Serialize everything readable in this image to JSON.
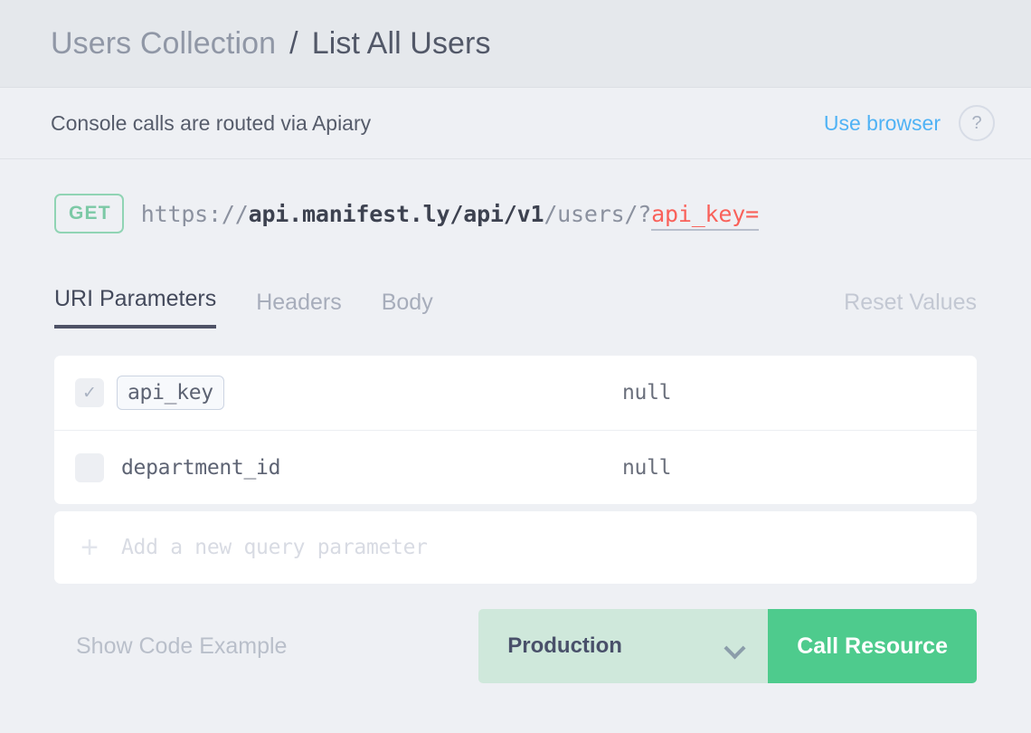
{
  "breadcrumb": {
    "parent": "Users Collection",
    "separator": "/",
    "current": "List All Users"
  },
  "console_notice": {
    "message": "Console calls are routed via Apiary",
    "use_browser_label": "Use browser",
    "help_icon": "?"
  },
  "request": {
    "method": "GET",
    "url_scheme": "https://",
    "url_host": "api.manifest.ly/api/v1",
    "url_path": "/users/?",
    "url_query": "api_key="
  },
  "tabs": [
    {
      "label": "URI Parameters",
      "active": true
    },
    {
      "label": "Headers",
      "active": false
    },
    {
      "label": "Body",
      "active": false
    }
  ],
  "reset_values_label": "Reset Values",
  "parameters": [
    {
      "checked": true,
      "name": "api_key",
      "value": "null",
      "highlighted": true
    },
    {
      "checked": false,
      "name": "department_id",
      "value": "null",
      "highlighted": false
    }
  ],
  "add_parameter": {
    "icon": "+",
    "placeholder": "Add a new query parameter"
  },
  "footer": {
    "show_code_label": "Show Code Example",
    "environment": "Production",
    "call_button_label": "Call Resource"
  },
  "colors": {
    "page_bg": "#eef0f4",
    "header_bg": "#e5e8ec",
    "accent_green": "#4ecb8d",
    "method_green": "#90d4b4",
    "env_mint": "#cfe8db",
    "link_blue": "#4fb2f5",
    "param_red": "#f9615a",
    "tab_underline": "#4e5266"
  }
}
